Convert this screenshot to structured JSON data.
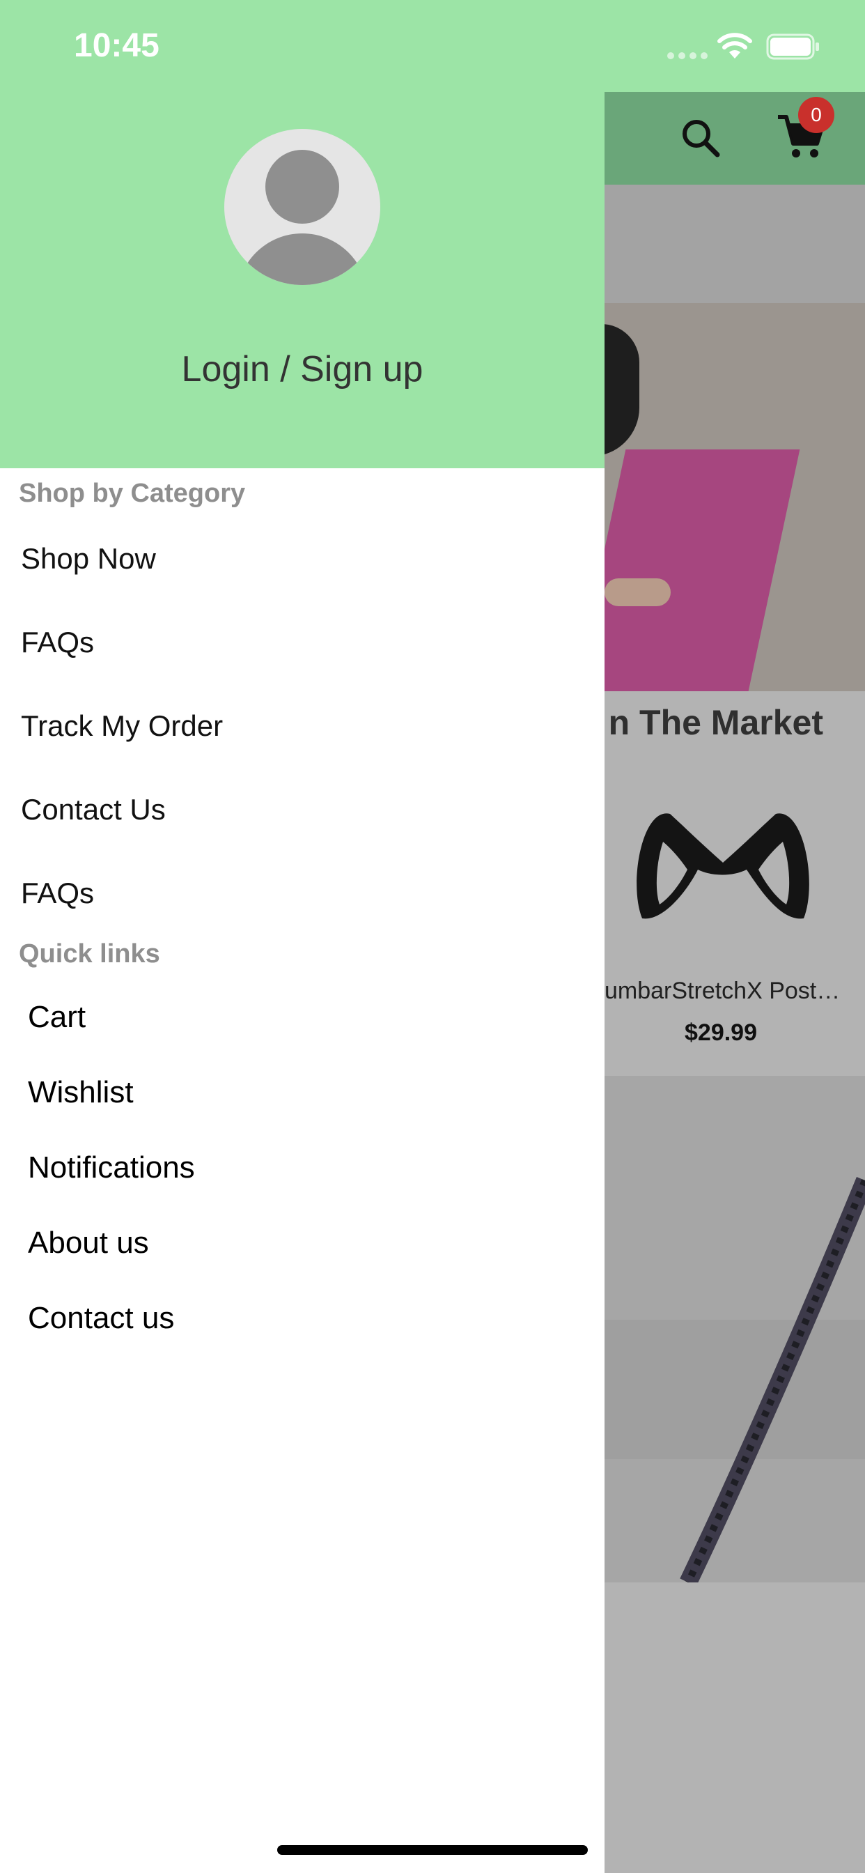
{
  "status_bar": {
    "time": "10:45"
  },
  "background": {
    "cart_badge_count": "0",
    "section_title": "n The Market",
    "product": {
      "name": "umbarStretchX Post…",
      "price": "$29.99"
    }
  },
  "drawer": {
    "login_label": "Login / Sign up",
    "shop_section": {
      "label": "Shop by Category",
      "items": [
        "Shop Now",
        "FAQs",
        "Track My Order",
        "Contact Us",
        "FAQs"
      ]
    },
    "quick_section": {
      "label": "Quick links",
      "items": [
        "Cart",
        "Wishlist",
        "Notifications",
        "About us",
        "Contact us"
      ]
    }
  },
  "colors": {
    "header_green": "#9ce4a6",
    "app_bar_green_dimmed": "#6aa679",
    "badge_red": "#c9302c",
    "section_label_gray": "#8e8e8e"
  },
  "icons": [
    "search-icon",
    "cart-icon",
    "wifi-icon",
    "battery-icon",
    "avatar-placeholder-icon"
  ]
}
